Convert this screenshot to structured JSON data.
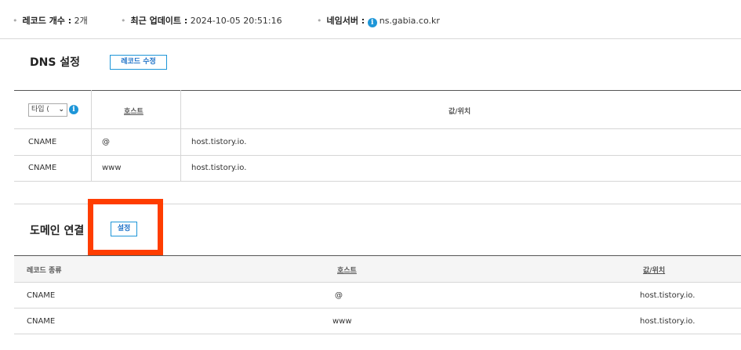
{
  "info": {
    "record_count_label": "레코드 개수 :",
    "record_count_value": "2개",
    "updated_label": "최근 업데이트 :",
    "updated_value": "2024-10-05 20:51:16",
    "nameserver_label": "네임서버 :",
    "nameserver_icon": "info-icon",
    "nameserver_value": "ns.gabia.co.kr"
  },
  "dns": {
    "title": "DNS 설정",
    "edit_button": "레코드 수정",
    "type_select_value": "타입 (",
    "columns": {
      "host": "호스트",
      "value": "값/위치"
    },
    "rows": [
      {
        "type": "CNAME",
        "host": "@",
        "value": "host.tistory.io."
      },
      {
        "type": "CNAME",
        "host": "www",
        "value": "host.tistory.io."
      }
    ]
  },
  "domain": {
    "title": "도메인 연결",
    "setup_button": "설정",
    "columns": {
      "type": "레코드 종류",
      "host": "호스트",
      "value": "값/위치"
    },
    "rows": [
      {
        "type": "CNAME",
        "host": "@",
        "value": "host.tistory.io."
      },
      {
        "type": "CNAME",
        "host": "www",
        "value": "host.tistory.io."
      }
    ]
  },
  "colors": {
    "accent": "#1e96d8",
    "highlight": "#ff3d00"
  }
}
